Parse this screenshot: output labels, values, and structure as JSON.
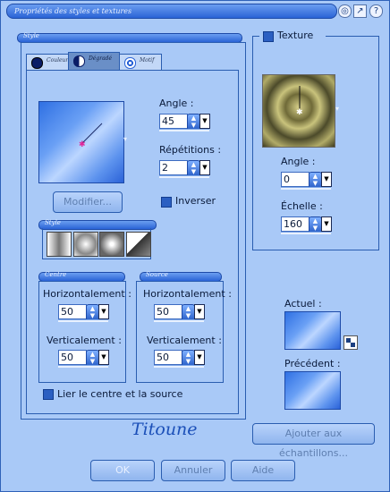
{
  "window": {
    "title": "Propriétés des styles et textures"
  },
  "title_controls": [
    "restore-icon",
    "pin-icon",
    "help-icon"
  ],
  "style_section": {
    "header": "Style",
    "tabs": [
      {
        "label": "Couleur",
        "icon": "color-circle-icon"
      },
      {
        "label": "Dégradé",
        "icon": "gradient-icon",
        "active": true
      },
      {
        "label": "Motif",
        "icon": "pattern-icon"
      }
    ]
  },
  "gradient": {
    "angle_label": "Angle :",
    "angle_value": "45",
    "repeats_label": "Répétitions :",
    "repeats_value": "2",
    "modify_button": "Modifier...",
    "invert_label": "Inverser",
    "style_subheader": "Style",
    "center_header": "Centre",
    "source_header": "Source",
    "center_h_label": "Horizontalement :",
    "center_h_value": "50",
    "center_v_label": "Verticalement :",
    "center_v_value": "50",
    "source_h_label": "Horizontalement :",
    "source_h_value": "50",
    "source_v_label": "Verticalement :",
    "source_v_value": "50",
    "link_label": "Lier le centre et la source"
  },
  "texture": {
    "label": "Texture",
    "angle_label": "Angle :",
    "angle_value": "0",
    "scale_label": "Échelle :",
    "scale_value": "160"
  },
  "preview": {
    "current_label": "Actuel :",
    "previous_label": "Précédent :"
  },
  "signature": "Titoune",
  "buttons": {
    "add_swatch": "Ajouter aux échantillons...",
    "ok": "OK",
    "cancel": "Annuler",
    "help": "Aide"
  },
  "colors": {
    "window_bg": "#a9c9f7",
    "accent": "#2a63d6",
    "border": "#2a5db0",
    "signature": "#1b4fb8"
  }
}
